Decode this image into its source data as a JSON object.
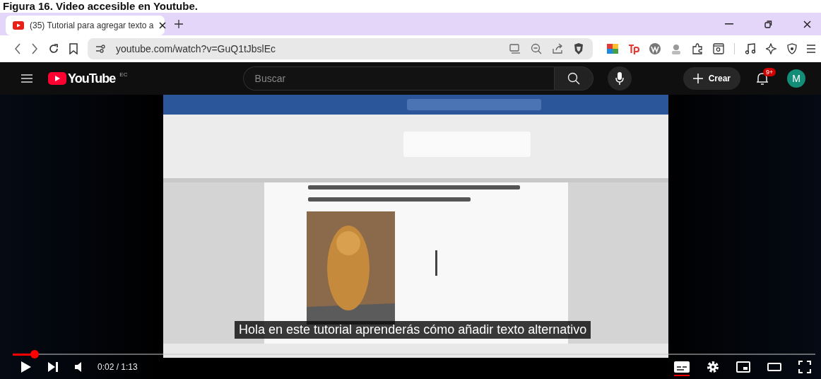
{
  "caption": "Figura 16. Video accesible en Youtube.",
  "browser": {
    "tabs": [
      {
        "title": "(35) Tutorial para agregar texto a",
        "selected": true
      }
    ],
    "address": "youtube.com/watch?v=GuQ1tJbslEc"
  },
  "youtube": {
    "logo": "YouTube",
    "region": "EC",
    "search": {
      "placeholder": "Buscar"
    },
    "create": "Crear",
    "notifications": "9+",
    "avatar": "M"
  },
  "player": {
    "subtitle": "Hola en este tutorial aprenderás cómo añadir texto alternativo",
    "level": 0.027,
    "time": "0:02 / 1:13",
    "captions_on": true
  }
}
